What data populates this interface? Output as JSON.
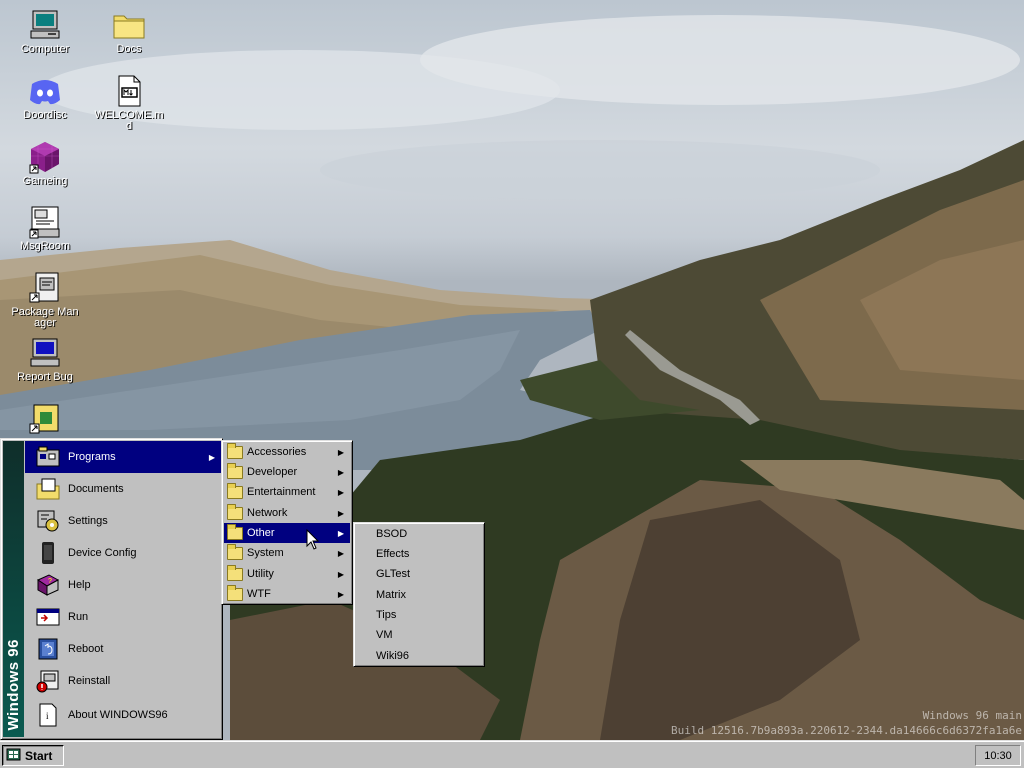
{
  "desktop": {
    "icons": [
      {
        "label": "Computer",
        "icon": "computer-icon"
      },
      {
        "label": "Docs",
        "icon": "folder-icon"
      },
      {
        "label": "Doordisc",
        "icon": "discord-icon"
      },
      {
        "label": "WELCOME.md",
        "icon": "markdown-file-icon"
      },
      {
        "label": "Gameing",
        "icon": "game-cube-icon"
      },
      {
        "label": "MsgRoom",
        "icon": "chat-room-icon"
      },
      {
        "label": "Package Manager",
        "icon": "package-manager-icon"
      },
      {
        "label": "Report Bug",
        "icon": "report-bug-icon"
      },
      {
        "label": "",
        "icon": "app-shortcut-icon"
      }
    ]
  },
  "build": {
    "line1": "Windows 96 main",
    "line2": "Build 12516.7b9a893a.220612-2344.da14666c6d6372fa1a6e"
  },
  "start_menu": {
    "side_label": "Windows 96",
    "items": [
      {
        "label": "Programs",
        "icon": "programs-icon",
        "has_submenu": true,
        "active": true
      },
      {
        "label": "Documents",
        "icon": "documents-icon"
      },
      {
        "label": "Settings",
        "icon": "settings-icon"
      },
      {
        "label": "Device Config",
        "icon": "device-icon"
      },
      {
        "label": "Help",
        "icon": "help-book-icon"
      },
      {
        "label": "Run",
        "icon": "run-icon"
      },
      {
        "label": "Reboot",
        "icon": "reboot-icon"
      },
      {
        "label": "Reinstall",
        "icon": "reinstall-icon"
      },
      {
        "label": "About WINDOWS96",
        "icon": "info-icon"
      }
    ]
  },
  "programs_menu": {
    "items": [
      {
        "label": "Accessories"
      },
      {
        "label": "Developer"
      },
      {
        "label": "Entertainment"
      },
      {
        "label": "Network"
      },
      {
        "label": "Other",
        "active": true
      },
      {
        "label": "System"
      },
      {
        "label": "Utility"
      },
      {
        "label": "WTF"
      }
    ]
  },
  "other_menu": {
    "items": [
      "BSOD",
      "Effects",
      "GLTest",
      "Matrix",
      "Tips",
      "VM",
      "Wiki96"
    ]
  },
  "taskbar": {
    "start_label": "Start",
    "clock": "10:30"
  },
  "colors": {
    "highlight": "#000080",
    "face": "#c0c0c0",
    "side_bar": "#0a5a50"
  }
}
